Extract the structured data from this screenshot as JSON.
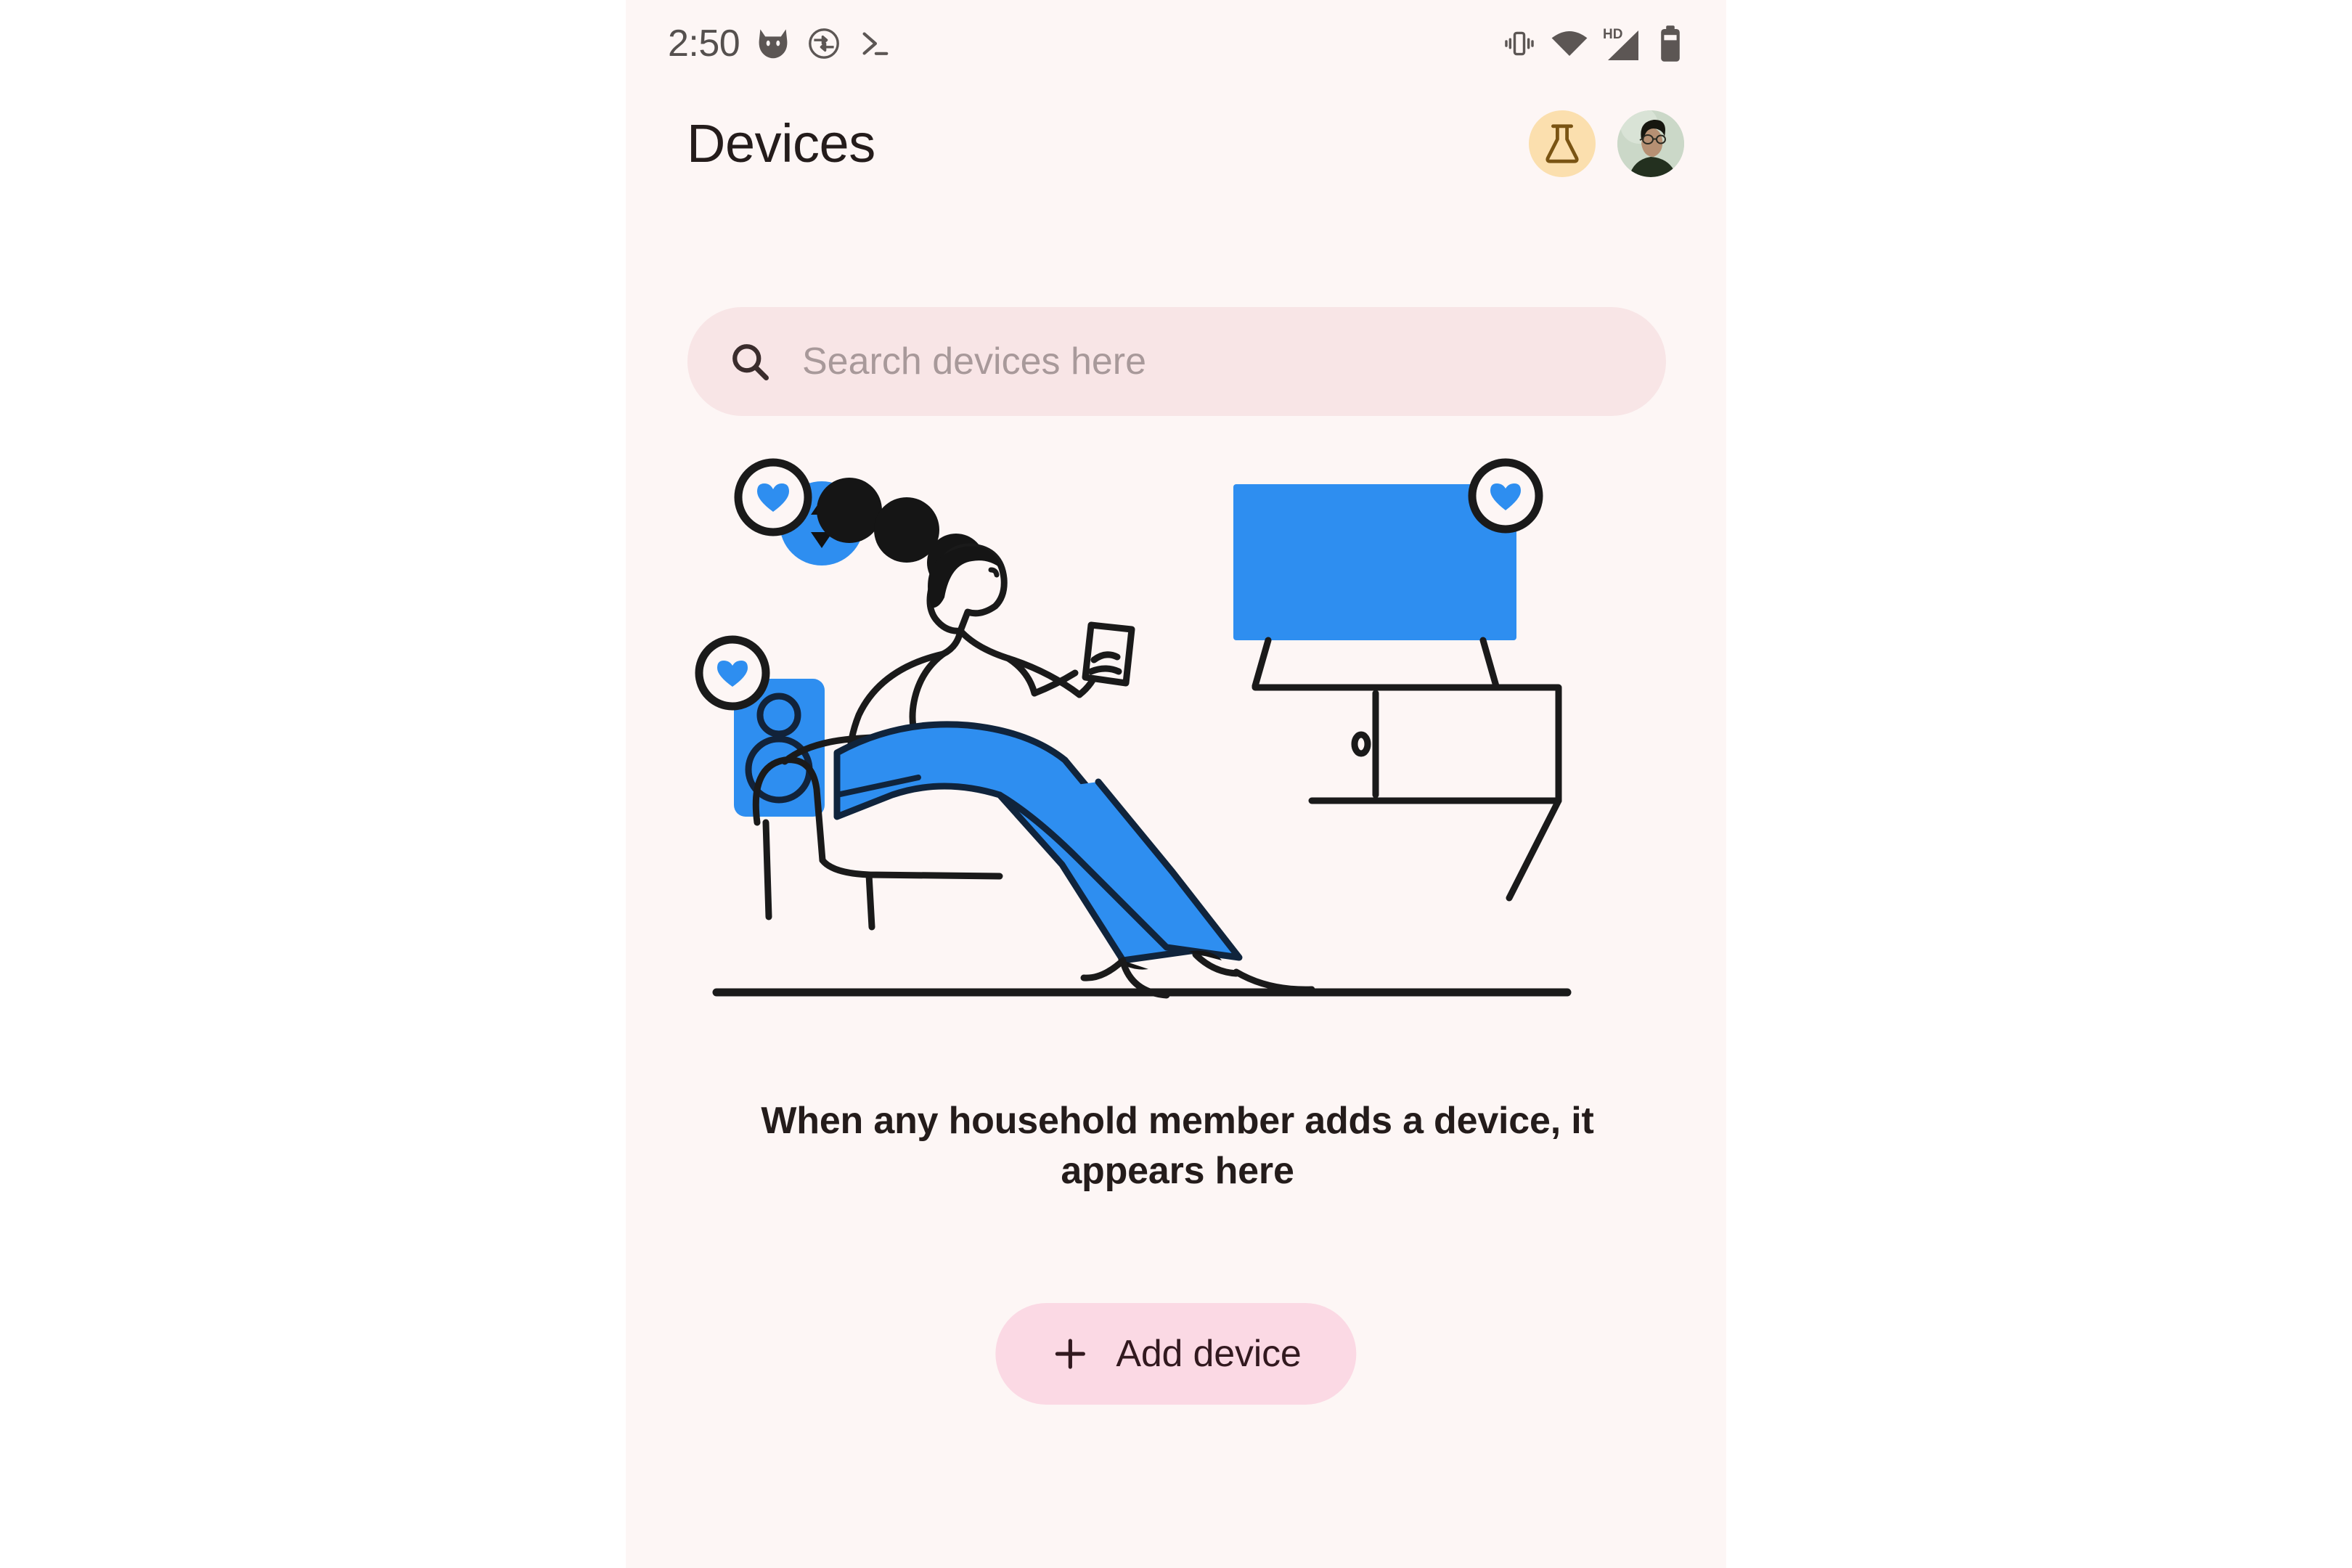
{
  "status_bar": {
    "time": "2:50",
    "left_icons": [
      "cat-face-icon",
      "sync-rotate-icon",
      "terminal-prompt-icon"
    ],
    "right_icons": [
      "vibrate-icon",
      "wifi-icon",
      "hd-signal-icon",
      "battery-icon"
    ],
    "hd_label": "HD"
  },
  "app_bar": {
    "title": "Devices",
    "flask_button_name": "flask-icon",
    "avatar_button_name": "account-avatar"
  },
  "search": {
    "placeholder": "Search devices here",
    "value": "",
    "icon": "search-icon"
  },
  "illustration": {
    "name": "empty-devices-illustration",
    "alt": "Person sitting in armchair holding a phone with a TV, speaker and thermostat nearby, each marked with a heart badge",
    "badges": [
      "heart-badge-thermostat",
      "heart-badge-tv",
      "heart-badge-speaker"
    ]
  },
  "empty_state": {
    "message": "When any household member adds a device, it appears here"
  },
  "add_device": {
    "label": "Add device",
    "icon": "plus-icon"
  },
  "colors": {
    "page_background": "#fdf6f5",
    "search_background": "#f8e5e6",
    "button_background": "#fbd9e4",
    "button_text": "#32191f",
    "accent_blue": "#2e8ef0",
    "ink": "#241c1b",
    "flask_chip": "#fbdfae",
    "placeholder": "#a8999a"
  }
}
